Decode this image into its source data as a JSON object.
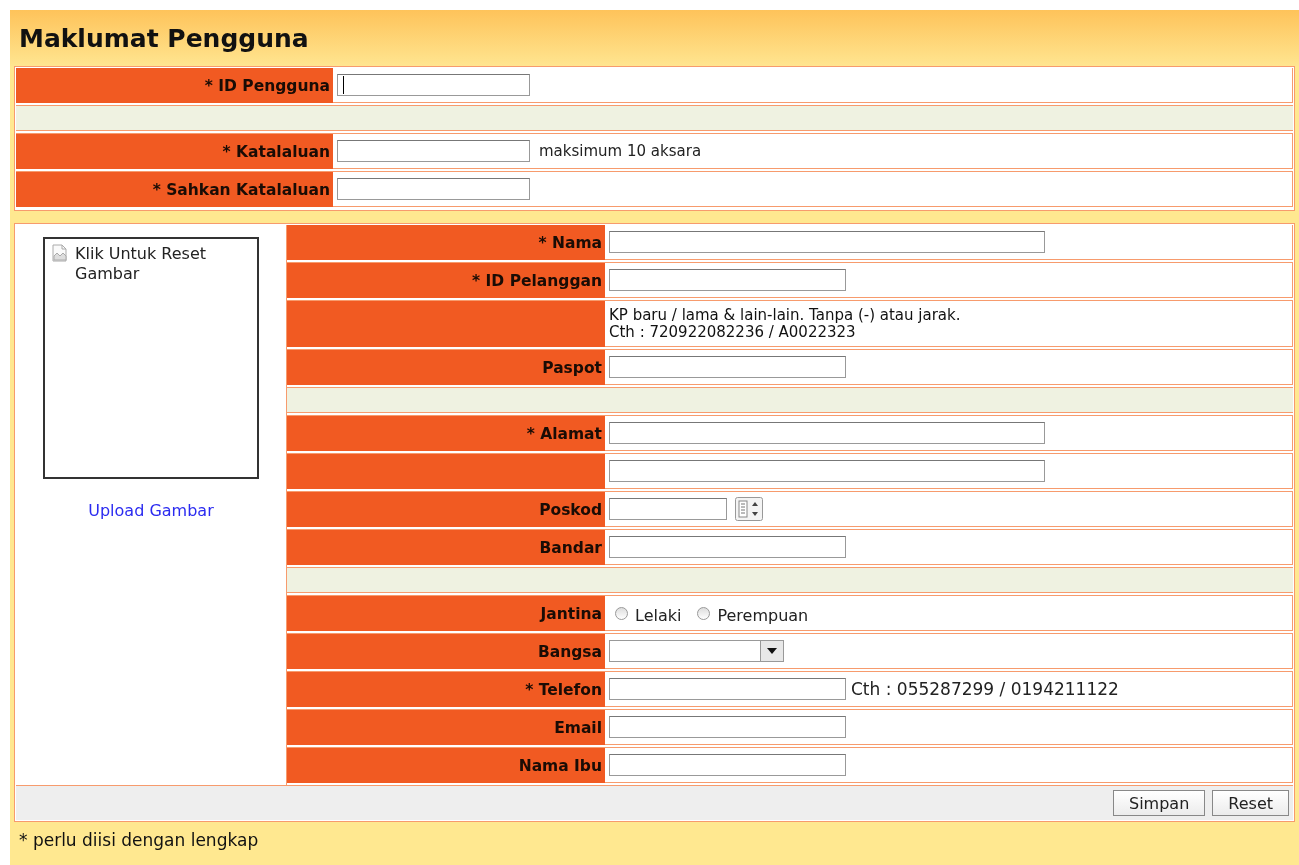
{
  "title": "Maklumat Pengguna",
  "account_rows": [
    {
      "kind": "input",
      "label": "* ID Pengguna",
      "focused": true
    },
    {
      "kind": "spacer"
    },
    {
      "kind": "input",
      "label": "* Katalaluan",
      "hint": "maksimum 10 aksara"
    },
    {
      "kind": "input",
      "label": "* Sahkan Katalaluan"
    }
  ],
  "image_panel": {
    "reset_text": "Klik Untuk Reset Gambar",
    "upload_link": "Upload Gambar"
  },
  "profile_rows": [
    {
      "kind": "long_input",
      "label": "* Nama"
    },
    {
      "kind": "input",
      "label": "* ID Pelanggan"
    },
    {
      "kind": "note",
      "lines": [
        "KP baru / lama & lain-lain. Tanpa (-) atau jarak.",
        "Cth : 720922082236 / A0022323"
      ]
    },
    {
      "kind": "input",
      "label": "Paspot"
    },
    {
      "kind": "spacer"
    },
    {
      "kind": "long_input",
      "label": "* Alamat"
    },
    {
      "kind": "long_input"
    },
    {
      "kind": "postcode",
      "label": "Poskod"
    },
    {
      "kind": "input",
      "label": "Bandar"
    },
    {
      "kind": "spacer"
    },
    {
      "kind": "radio",
      "label": "Jantina",
      "options": [
        {
          "label": "Lelaki",
          "selected": false
        },
        {
          "label": "Perempuan",
          "selected": false
        }
      ]
    },
    {
      "kind": "select",
      "label": "Bangsa"
    },
    {
      "kind": "input",
      "label": "* Telefon",
      "hint": "Cth : 055287299 / 0194211122"
    },
    {
      "kind": "input",
      "label": "Email"
    },
    {
      "kind": "input",
      "label": "Nama Ibu"
    }
  ],
  "buttons": [
    "Simpan",
    "Reset"
  ],
  "footnote": "* perlu diisi dengan lengkap"
}
